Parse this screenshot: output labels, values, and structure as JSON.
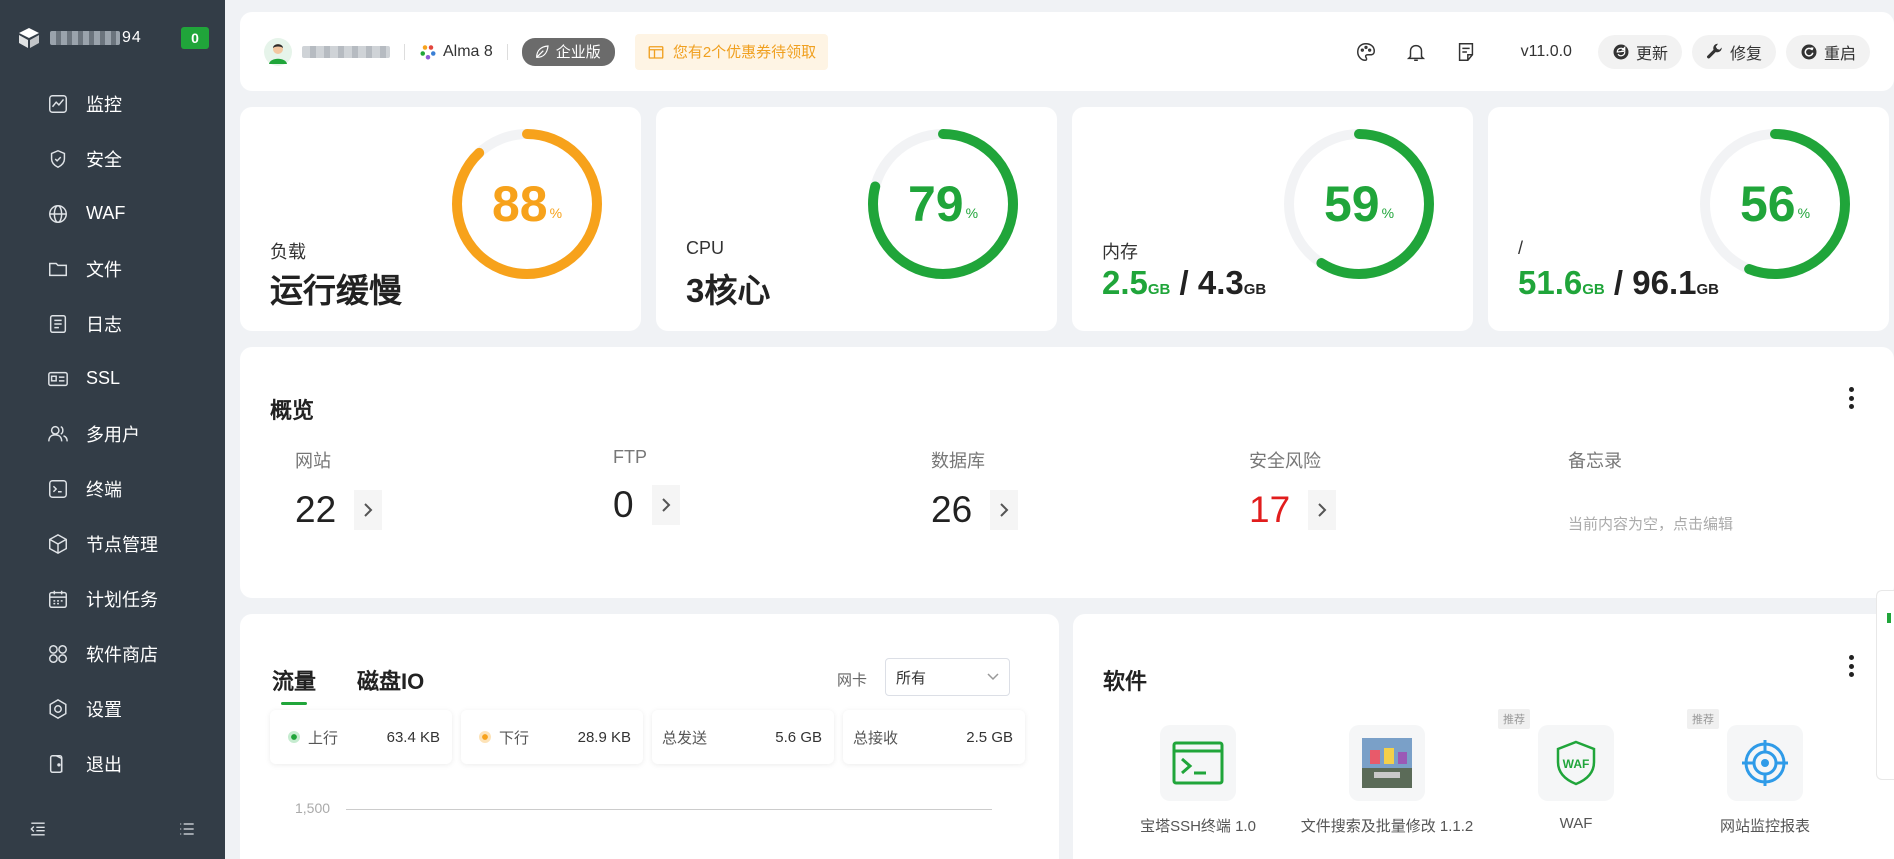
{
  "sidebar": {
    "host_suffix": "94",
    "task_count": "0",
    "items": [
      {
        "label": "监控",
        "icon": "monitor-icon"
      },
      {
        "label": "安全",
        "icon": "shield-icon"
      },
      {
        "label": "WAF",
        "icon": "globe-icon"
      },
      {
        "label": "文件",
        "icon": "folder-icon"
      },
      {
        "label": "日志",
        "icon": "log-icon"
      },
      {
        "label": "SSL",
        "icon": "id-card-icon"
      },
      {
        "label": "多用户",
        "icon": "users-icon"
      },
      {
        "label": "终端",
        "icon": "terminal-icon"
      },
      {
        "label": "节点管理",
        "icon": "cube-icon"
      },
      {
        "label": "计划任务",
        "icon": "calendar-icon"
      },
      {
        "label": "软件商店",
        "icon": "apps-icon"
      },
      {
        "label": "设置",
        "icon": "settings-icon"
      },
      {
        "label": "退出",
        "icon": "logout-icon"
      }
    ]
  },
  "topbar": {
    "os": "Alma 8",
    "edition": "企业版",
    "coupon": "您有2个优惠券待领取",
    "version": "v11.0.0",
    "update_label": "更新",
    "repair_label": "修复",
    "restart_label": "重启"
  },
  "stats": {
    "load": {
      "title": "负载",
      "value": "运行缓慢",
      "percent": 88,
      "percent_text": "88",
      "unit": "%",
      "color": "#f7a21b"
    },
    "cpu": {
      "title": "CPU",
      "value": "3核心",
      "percent": 79,
      "percent_text": "79",
      "unit": "%",
      "color": "#20a53a"
    },
    "memory": {
      "title": "内存",
      "used": "2.5",
      "used_unit": "GB",
      "slash": " / ",
      "total": "4.3",
      "total_unit": "GB",
      "percent": 59,
      "percent_text": "59",
      "unit": "%",
      "color": "#20a53a"
    },
    "disk": {
      "title": "/",
      "used": "51.6",
      "used_unit": "GB",
      "slash": " / ",
      "total": "96.1",
      "total_unit": "GB",
      "percent": 56,
      "percent_text": "56",
      "unit": "%",
      "color": "#20a53a"
    }
  },
  "overview": {
    "title": "概览",
    "items": [
      {
        "label": "网站",
        "value": "22"
      },
      {
        "label": "FTP",
        "value": "0"
      },
      {
        "label": "数据库",
        "value": "26"
      },
      {
        "label": "安全风险",
        "value": "17",
        "color": "#e11d1d"
      }
    ],
    "memo_label": "备忘录",
    "memo_text": "当前内容为空，点击编辑"
  },
  "traffic": {
    "tab_traffic": "流量",
    "tab_disk": "磁盘IO",
    "nic_label": "网卡",
    "nic_value": "所有",
    "up_label": "上行",
    "up_value": "63.4 KB",
    "down_label": "下行",
    "down_value": "28.9 KB",
    "sent_label": "总发送",
    "sent_value": "5.6 GB",
    "recv_label": "总接收",
    "recv_value": "2.5 GB",
    "y_tick": "1,500",
    "up_color": "#20a53a",
    "down_color": "#f7a21b"
  },
  "software": {
    "title": "软件",
    "recommend": "推荐",
    "items": [
      {
        "name": "宝塔SSH终端 1.0",
        "icon": "ssh-terminal-icon"
      },
      {
        "name": "文件搜索及批量修改 1.1.2",
        "icon": "file-search-icon"
      },
      {
        "name": "WAF",
        "icon": "waf-icon"
      },
      {
        "name": "网站监控报表",
        "icon": "site-monitor-icon"
      }
    ]
  }
}
